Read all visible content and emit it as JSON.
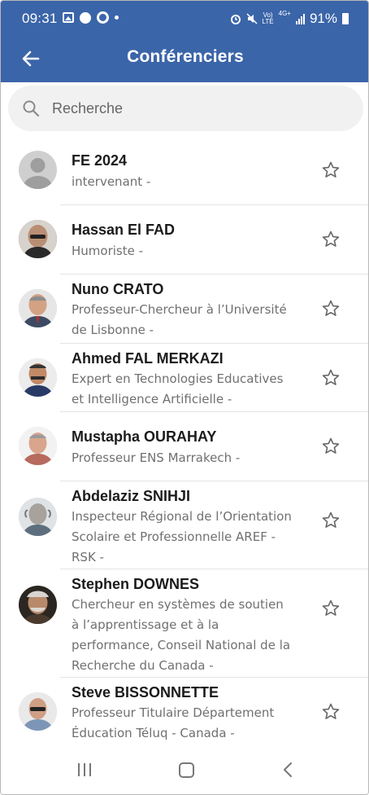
{
  "status_bar": {
    "time": "09:31",
    "battery": "91%",
    "lte_top": "Vo)",
    "lte_bottom": "LTE",
    "net_top": "4G+",
    "icons_left": [
      "photo-icon",
      "soccer-ball-icon",
      "ring-icon",
      "dot-icon"
    ],
    "icons_right": [
      "alarm-icon",
      "mute-icon",
      "volte-icon",
      "4g-icon",
      "signal-icon",
      "battery-icon"
    ]
  },
  "app_bar": {
    "title": "Conférenciers",
    "back_icon": "arrow-left-icon",
    "color": "#3b65a9"
  },
  "search": {
    "placeholder": "Recherche",
    "value": ""
  },
  "speakers": [
    {
      "name": "FE 2024",
      "lines": [
        "intervenant -"
      ],
      "avatar": "placeholder"
    },
    {
      "name": "Hassan El FAD",
      "lines": [
        "Humoriste -"
      ],
      "avatar": "photo"
    },
    {
      "name": "Nuno CRATO",
      "lines": [
        "Professeur-Chercheur à l’Université",
        "de Lisbonne -"
      ],
      "avatar": "photo"
    },
    {
      "name": "Ahmed FAL MERKAZI",
      "lines": [
        "Expert en Technologies Educatives",
        "et Intelligence Artificielle -"
      ],
      "avatar": "photo"
    },
    {
      "name": "Mustapha OURAHAY",
      "lines": [
        "Professeur ENS Marrakech -"
      ],
      "avatar": "photo"
    },
    {
      "name": "Abdelaziz SNIHJI",
      "lines": [
        "Inspecteur Régional de l’Orientation",
        "Scolaire et Professionnelle AREF -",
        "RSK -"
      ],
      "avatar": "photo"
    },
    {
      "name": "Stephen DOWNES",
      "lines": [
        "Chercheur en systèmes de soutien",
        "à l’apprentissage et à la",
        "performance, Conseil National de la",
        "Recherche du Canada -"
      ],
      "avatar": "photo"
    },
    {
      "name": "Steve BISSONNETTE",
      "lines": [
        "Professeur Titulaire Département",
        "Éducation Téluq - Canada -"
      ],
      "avatar": "photo"
    }
  ],
  "nav_bar": {
    "icons": [
      "recent-apps-icon",
      "home-icon",
      "back-icon"
    ]
  }
}
